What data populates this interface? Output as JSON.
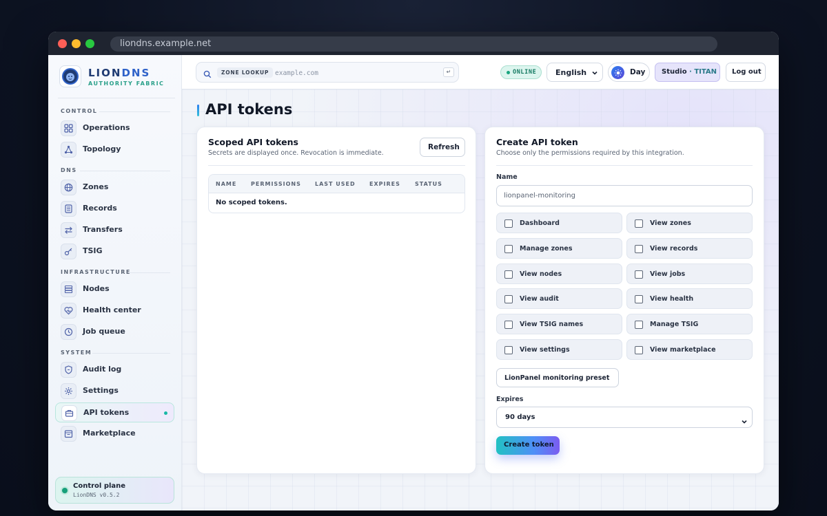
{
  "browser": {
    "url": "liondns.example.net"
  },
  "brand": {
    "name_part1": "LION",
    "name_part2": "DNS",
    "subtitle": "AUTHORITY FABRIC"
  },
  "sidebar": {
    "sections": [
      {
        "label": "CONTROL",
        "items": [
          {
            "label": "Operations",
            "icon": "operations-icon"
          },
          {
            "label": "Topology",
            "icon": "topology-icon"
          }
        ]
      },
      {
        "label": "DNS",
        "items": [
          {
            "label": "Zones",
            "icon": "globe-icon"
          },
          {
            "label": "Records",
            "icon": "records-icon"
          },
          {
            "label": "Transfers",
            "icon": "transfer-icon"
          },
          {
            "label": "TSIG",
            "icon": "key-icon"
          }
        ]
      },
      {
        "label": "INFRASTRUCTURE",
        "items": [
          {
            "label": "Nodes",
            "icon": "server-icon"
          },
          {
            "label": "Health center",
            "icon": "heart-icon"
          },
          {
            "label": "Job queue",
            "icon": "clock-icon"
          }
        ]
      },
      {
        "label": "SYSTEM",
        "items": [
          {
            "label": "Audit log",
            "icon": "shield-icon"
          },
          {
            "label": "Settings",
            "icon": "gear-icon"
          },
          {
            "label": "API tokens",
            "icon": "briefcase-icon",
            "active": true
          },
          {
            "label": "Marketplace",
            "icon": "store-icon"
          }
        ]
      }
    ],
    "footer": {
      "title": "Control plane",
      "version": "LionDNS v0.5.2"
    }
  },
  "topbar": {
    "search_badge": "ZONE LOOKUP",
    "search_placeholder": "example.com",
    "enter_key": "↵",
    "status": "ONLINE",
    "language": "English",
    "theme": "Day",
    "studio_part1": "Studio",
    "studio_sep": " · ",
    "studio_part2": "TITAN",
    "logout": "Log out"
  },
  "page": {
    "title": "API tokens"
  },
  "tokens_card": {
    "title": "Scoped API tokens",
    "subtitle": "Secrets are displayed once. Revocation is immediate.",
    "refresh": "Refresh",
    "columns": [
      "NAME",
      "PERMISSIONS",
      "LAST USED",
      "EXPIRES",
      "STATUS"
    ],
    "empty": "No scoped tokens."
  },
  "create_card": {
    "title": "Create API token",
    "subtitle": "Choose only the permissions required by this integration.",
    "name_label": "Name",
    "name_value": "lionpanel-monitoring",
    "permissions": [
      {
        "label": "Dashboard",
        "checked": false
      },
      {
        "label": "View zones",
        "checked": false
      },
      {
        "label": "Manage zones",
        "checked": false
      },
      {
        "label": "View records",
        "checked": false
      },
      {
        "label": "View nodes",
        "checked": false
      },
      {
        "label": "View jobs",
        "checked": false
      },
      {
        "label": "View audit",
        "checked": false
      },
      {
        "label": "View health",
        "checked": false
      },
      {
        "label": "View TSIG names",
        "checked": false
      },
      {
        "label": "Manage TSIG",
        "checked": false
      },
      {
        "label": "View settings",
        "checked": false
      },
      {
        "label": "View marketplace",
        "checked": false
      }
    ],
    "preset": "LionPanel monitoring preset",
    "expires_label": "Expires",
    "expires_value": "90 days",
    "create": "Create token"
  }
}
